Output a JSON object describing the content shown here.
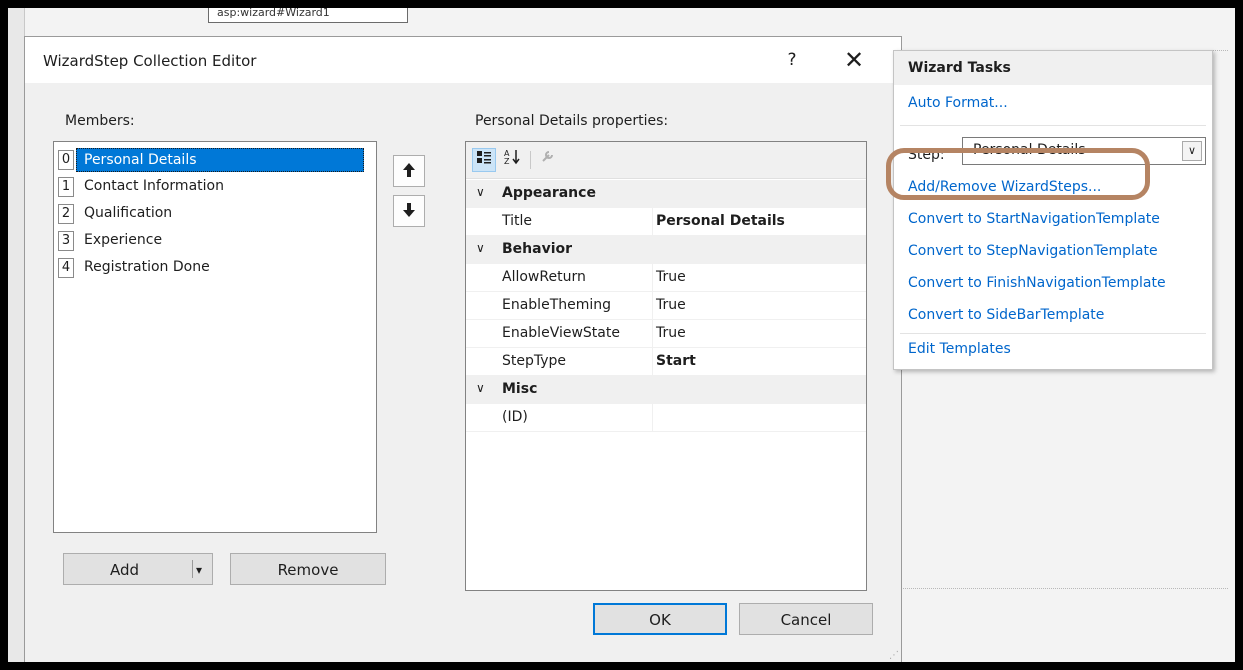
{
  "background": {
    "tag_text": "asp:wizard#Wizard1"
  },
  "dialog": {
    "title": "WizardStep Collection Editor",
    "help_glyph": "?",
    "close_glyph": "✕",
    "members_label": "Members:",
    "members": [
      {
        "index": "0",
        "name": "Personal Details",
        "selected": true
      },
      {
        "index": "1",
        "name": "Contact Information"
      },
      {
        "index": "2",
        "name": "Qualification"
      },
      {
        "index": "3",
        "name": "Experience"
      },
      {
        "index": "4",
        "name": "Registration Done"
      }
    ],
    "move_up_glyph": "🠕",
    "move_down_glyph": "🠗",
    "add_label": "Add",
    "add_dropdown_glyph": "▾",
    "remove_label": "Remove",
    "properties_label": "Personal Details properties:",
    "categories": [
      {
        "name": "Appearance",
        "props": [
          {
            "name": "Title",
            "value": "Personal Details",
            "bold": true
          }
        ]
      },
      {
        "name": "Behavior",
        "props": [
          {
            "name": "AllowReturn",
            "value": "True"
          },
          {
            "name": "EnableTheming",
            "value": "True"
          },
          {
            "name": "EnableViewState",
            "value": "True"
          },
          {
            "name": "StepType",
            "value": "Start",
            "bold": true
          }
        ]
      },
      {
        "name": "Misc",
        "props": [
          {
            "name": "(ID)",
            "value": ""
          }
        ]
      }
    ],
    "ok_label": "OK",
    "cancel_label": "Cancel"
  },
  "tasks": {
    "header": "Wizard Tasks",
    "auto_format": "Auto Format...",
    "step_label": "Step:",
    "step_value": "Personal Details",
    "links": [
      "Add/Remove WizardSteps...",
      "Convert to StartNavigationTemplate",
      "Convert to StepNavigationTemplate",
      "Convert to FinishNavigationTemplate",
      "Convert to SideBarTemplate"
    ],
    "edit_templates": "Edit Templates"
  },
  "colors": {
    "accent": "#0078d7",
    "link": "#0066cc",
    "highlight": "#b58463"
  }
}
